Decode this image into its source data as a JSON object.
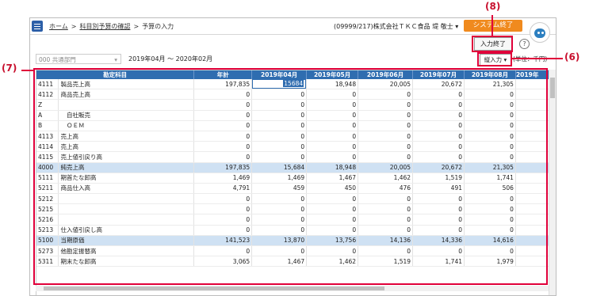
{
  "breadcrumb": {
    "home": "ホーム",
    "budget_check": "科目別予算の確認",
    "current": "予算の入力",
    "sep": ">"
  },
  "company_user": "(09999/217)株式会社ＴＫＣ食品 堤 敬士",
  "user_menu_caret": "▾",
  "system_end_label": "システム終了",
  "input_end_label": "入力終了",
  "help_label": "?",
  "department": "000 共通部門",
  "department_caret": "▾",
  "period": "2019年04月 ～ 2020年02月",
  "vertical_input_label": "縦入力 ▾",
  "unit_label": "(単位：千円)",
  "callouts": {
    "c8": "(8)",
    "c6": "(6)",
    "c7": "(7)"
  },
  "columns": [
    "勘定科目",
    "年計",
    "2019年04月",
    "2019年05月",
    "2019年06月",
    "2019年07月",
    "2019年08月",
    "2019年"
  ],
  "rows": [
    {
      "code": "4111",
      "name": "製品売上高",
      "values": [
        "197,835",
        "15684",
        "18,948",
        "20,005",
        "20,672",
        "21,305",
        ""
      ],
      "summary": false
    },
    {
      "code": "4112",
      "name": "商品売上高",
      "values": [
        "0",
        "0",
        "0",
        "0",
        "0",
        "0",
        ""
      ],
      "summary": false
    },
    {
      "code": "Z",
      "name": "",
      "values": [
        "0",
        "0",
        "0",
        "0",
        "0",
        "0",
        ""
      ],
      "summary": false
    },
    {
      "code": "A",
      "name": "　自社販売",
      "values": [
        "0",
        "0",
        "0",
        "0",
        "0",
        "0",
        ""
      ],
      "summary": false
    },
    {
      "code": "B",
      "name": "　ＯＥＭ",
      "values": [
        "0",
        "0",
        "0",
        "0",
        "0",
        "0",
        ""
      ],
      "summary": false
    },
    {
      "code": "4113",
      "name": "売上高",
      "values": [
        "0",
        "0",
        "0",
        "0",
        "0",
        "0",
        ""
      ],
      "summary": false
    },
    {
      "code": "4114",
      "name": "売上高",
      "values": [
        "0",
        "0",
        "0",
        "0",
        "0",
        "0",
        ""
      ],
      "summary": false
    },
    {
      "code": "4115",
      "name": "売上値引戻り高",
      "values": [
        "0",
        "0",
        "0",
        "0",
        "0",
        "0",
        ""
      ],
      "summary": false
    },
    {
      "code": "4000",
      "name": "純売上高",
      "values": [
        "197,835",
        "15,684",
        "18,948",
        "20,005",
        "20,672",
        "21,305",
        ""
      ],
      "summary": true
    },
    {
      "code": "5111",
      "name": "期首たな卸高",
      "values": [
        "1,469",
        "1,469",
        "1,467",
        "1,462",
        "1,519",
        "1,741",
        ""
      ],
      "summary": false
    },
    {
      "code": "5211",
      "name": "商品仕入高",
      "values": [
        "4,791",
        "459",
        "450",
        "476",
        "491",
        "506",
        ""
      ],
      "summary": false
    },
    {
      "code": "5212",
      "name": "",
      "values": [
        "0",
        "0",
        "0",
        "0",
        "0",
        "0",
        ""
      ],
      "summary": false
    },
    {
      "code": "5215",
      "name": "",
      "values": [
        "0",
        "0",
        "0",
        "0",
        "0",
        "0",
        ""
      ],
      "summary": false
    },
    {
      "code": "5216",
      "name": "",
      "values": [
        "0",
        "0",
        "0",
        "0",
        "0",
        "0",
        ""
      ],
      "summary": false
    },
    {
      "code": "5213",
      "name": "仕入値引戻し高",
      "values": [
        "0",
        "0",
        "0",
        "0",
        "0",
        "0",
        ""
      ],
      "summary": false
    },
    {
      "code": "5100",
      "name": "当期原価",
      "values": [
        "141,523",
        "13,870",
        "13,756",
        "14,136",
        "14,336",
        "14,616",
        ""
      ],
      "summary": true
    },
    {
      "code": "5273",
      "name": "他勘定振替高",
      "values": [
        "0",
        "0",
        "0",
        "0",
        "0",
        "0",
        ""
      ],
      "summary": false
    },
    {
      "code": "5311",
      "name": "期末たな卸高",
      "values": [
        "3,065",
        "1,467",
        "1,462",
        "1,519",
        "1,741",
        "1,979",
        ""
      ],
      "summary": false
    }
  ]
}
